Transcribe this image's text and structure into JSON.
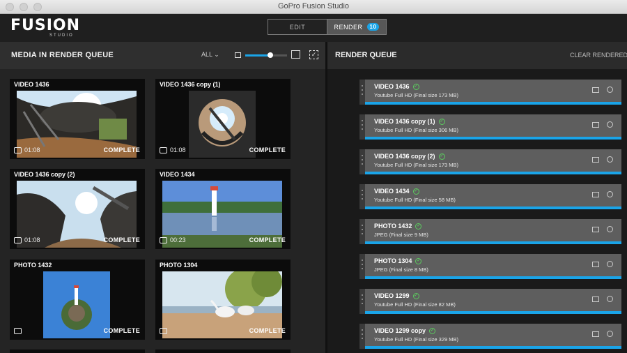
{
  "window": {
    "title": "GoPro Fusion Studio"
  },
  "app": {
    "logo": "FUSION",
    "logo_sub": "STUDIO"
  },
  "modes": {
    "edit": "EDIT",
    "render": "RENDER",
    "render_count": "10"
  },
  "media_panel": {
    "title": "MEDIA IN RENDER QUEUE",
    "filter": "ALL",
    "thumb_size_fraction": 0.6,
    "items": [
      {
        "title": "VIDEO 1436",
        "duration": "01:08",
        "status": "COMPLETE"
      },
      {
        "title": "VIDEO 1436 copy (1)",
        "duration": "01:08",
        "status": "COMPLETE"
      },
      {
        "title": "VIDEO 1436 copy (2)",
        "duration": "01:08",
        "status": "COMPLETE"
      },
      {
        "title": "VIDEO 1434",
        "duration": "00:23",
        "status": "COMPLETE"
      },
      {
        "title": "PHOTO 1432",
        "duration": "",
        "status": "COMPLETE"
      },
      {
        "title": "PHOTO 1304",
        "duration": "",
        "status": "COMPLETE"
      }
    ]
  },
  "queue": {
    "title": "RENDER QUEUE",
    "clear": "CLEAR RENDERED I",
    "items": [
      {
        "name": "VIDEO 1436",
        "detail": "Youtube Full HD  (Final size 173 MB)"
      },
      {
        "name": "VIDEO 1436 copy (1)",
        "detail": "Youtube Full HD  (Final size 306 MB)"
      },
      {
        "name": "VIDEO 1436 copy (2)",
        "detail": "Youtube Full HD  (Final size 173 MB)"
      },
      {
        "name": "VIDEO 1434",
        "detail": "Youtube Full HD  (Final size 58 MB)"
      },
      {
        "name": "PHOTO 1432",
        "detail": "JPEG  (Final size 9 MB)"
      },
      {
        "name": "PHOTO 1304",
        "detail": "JPEG  (Final size 8 MB)"
      },
      {
        "name": "VIDEO 1299",
        "detail": "Youtube Full HD  (Final size 82 MB)"
      },
      {
        "name": "VIDEO 1299 copy",
        "detail": "Youtube Full HD  (Final size 329 MB)"
      }
    ]
  },
  "colors": {
    "accent": "#1aa4e8",
    "success": "#5ccb5f"
  }
}
